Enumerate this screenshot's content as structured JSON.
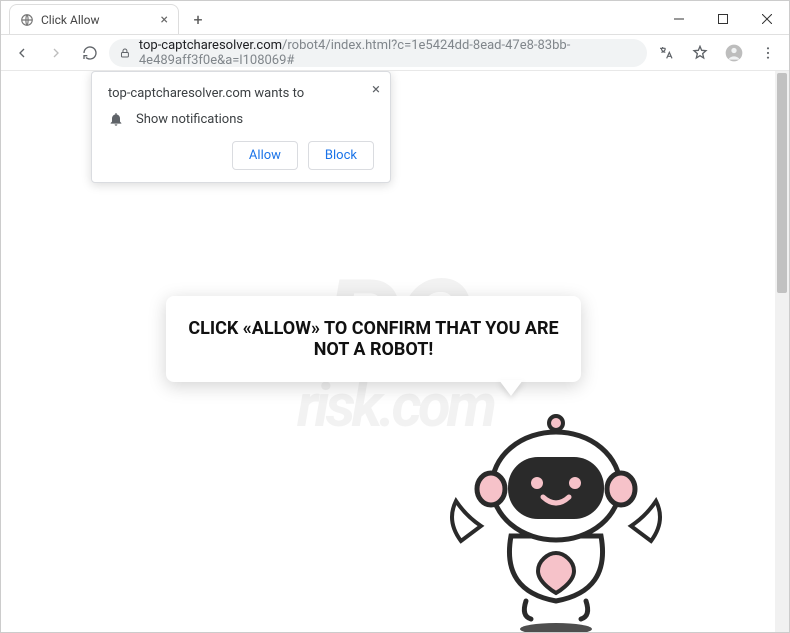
{
  "window": {
    "tab_title": "Click Allow",
    "url_domain": "top-captcharesolver.com",
    "url_path": "/robot4/index.html?c=1e5424dd-8ead-47e8-83bb-4e489aff3f0e&a=l108069#"
  },
  "permission": {
    "domain_text": "top-captcharesolver.com wants to",
    "item": "Show notifications",
    "allow": "Allow",
    "block": "Block"
  },
  "page": {
    "message": "CLICK «ALLOW» TO CONFIRM THAT YOU ARE NOT A ROBOT!"
  },
  "watermark": {
    "top": "PC",
    "bottom": "risk.com"
  }
}
